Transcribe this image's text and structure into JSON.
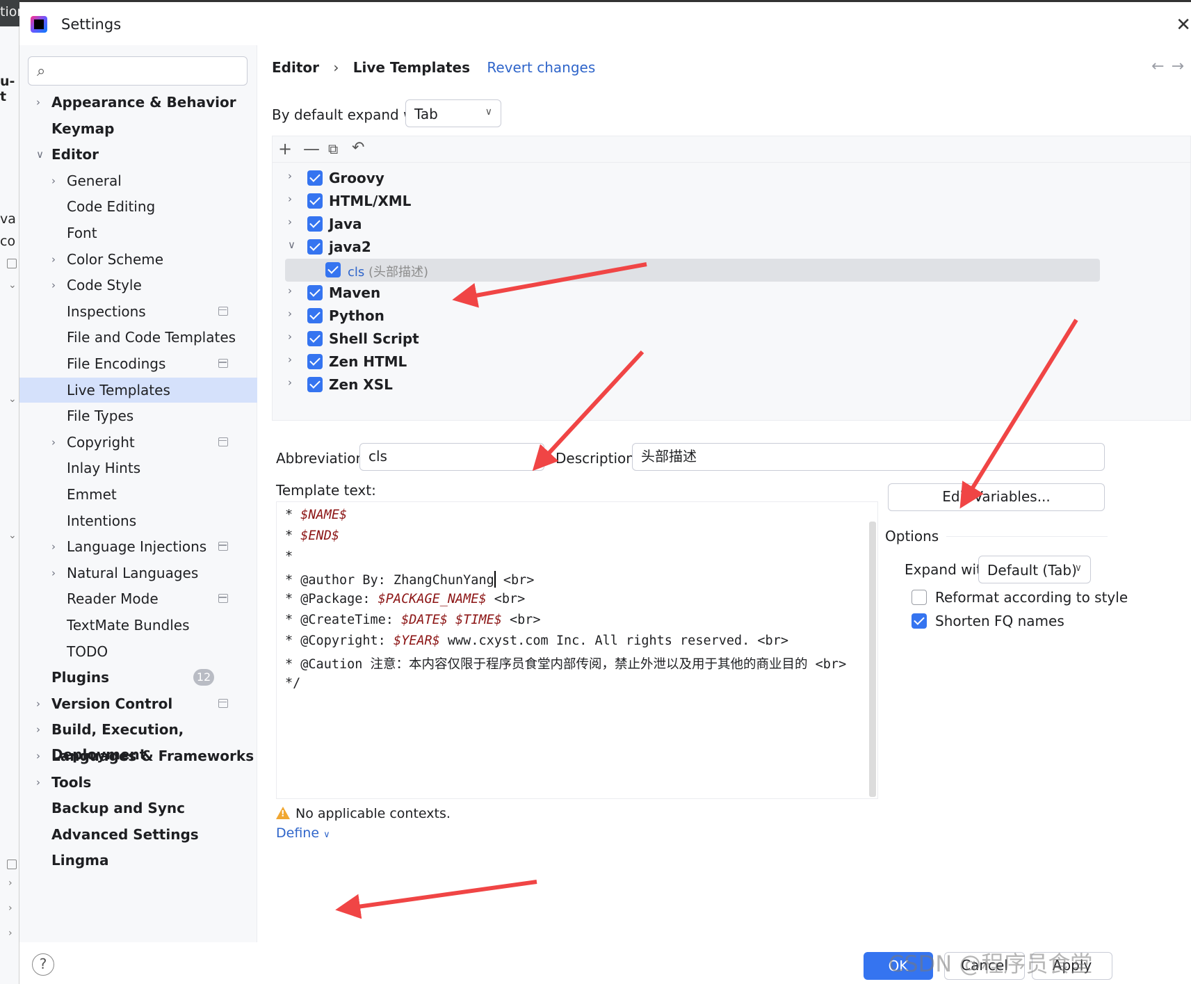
{
  "window": {
    "title": "Settings"
  },
  "background_fragments": [
    "tior",
    "u-t",
    "va",
    "co"
  ],
  "sidebar": {
    "search_placeholder": "",
    "items": [
      {
        "label": "Appearance & Behavior",
        "bold": true,
        "chevron": "right"
      },
      {
        "label": "Keymap",
        "bold": true
      },
      {
        "label": "Editor",
        "bold": true,
        "chevron": "down"
      },
      {
        "label": "General",
        "chevron": "right"
      },
      {
        "label": "Code Editing"
      },
      {
        "label": "Font"
      },
      {
        "label": "Color Scheme",
        "chevron": "right"
      },
      {
        "label": "Code Style",
        "chevron": "right"
      },
      {
        "label": "Inspections",
        "project_icon": true
      },
      {
        "label": "File and Code Templates"
      },
      {
        "label": "File Encodings",
        "project_icon": true
      },
      {
        "label": "Live Templates",
        "selected": true
      },
      {
        "label": "File Types"
      },
      {
        "label": "Copyright",
        "chevron": "right",
        "project_icon": true
      },
      {
        "label": "Inlay Hints"
      },
      {
        "label": "Emmet"
      },
      {
        "label": "Intentions"
      },
      {
        "label": "Language Injections",
        "chevron": "right",
        "project_icon": true
      },
      {
        "label": "Natural Languages",
        "chevron": "right"
      },
      {
        "label": "Reader Mode",
        "project_icon": true
      },
      {
        "label": "TextMate Bundles"
      },
      {
        "label": "TODO"
      },
      {
        "label": "Plugins",
        "bold": true,
        "badge": "12"
      },
      {
        "label": "Version Control",
        "bold": true,
        "chevron": "right",
        "project_icon": true
      },
      {
        "label": "Build, Execution, Deployment",
        "bold": true,
        "chevron": "right"
      },
      {
        "label": "Languages & Frameworks",
        "bold": true,
        "chevron": "right"
      },
      {
        "label": "Tools",
        "bold": true,
        "chevron": "right"
      },
      {
        "label": "Backup and Sync",
        "bold": true
      },
      {
        "label": "Advanced Settings",
        "bold": true
      },
      {
        "label": "Lingma",
        "bold": true
      }
    ]
  },
  "breadcrumb": {
    "parent": "Editor",
    "separator": "›",
    "current": "Live Templates",
    "revert": "Revert changes"
  },
  "expand": {
    "label": "By default expand with",
    "value": "Tab"
  },
  "template_groups": [
    {
      "name": "Groovy",
      "checked": true,
      "expanded": false
    },
    {
      "name": "HTML/XML",
      "checked": true,
      "expanded": false
    },
    {
      "name": "Java",
      "checked": true,
      "expanded": false
    },
    {
      "name": "java2",
      "checked": true,
      "expanded": true
    },
    {
      "name": "Maven",
      "checked": true,
      "expanded": false
    },
    {
      "name": "Python",
      "checked": true,
      "expanded": false
    },
    {
      "name": "Shell Script",
      "checked": true,
      "expanded": false
    },
    {
      "name": "Zen HTML",
      "checked": true,
      "expanded": false
    },
    {
      "name": "Zen XSL",
      "checked": true,
      "expanded": false
    }
  ],
  "selected_template": {
    "abbreviation": "cls",
    "description": "(头部描述)",
    "checked": true
  },
  "fields": {
    "abbreviation_label": "Abbreviation:",
    "abbreviation_value": "cls",
    "description_label": "Description:",
    "description_value": "头部描述",
    "template_text_label": "Template text:"
  },
  "template_text": [
    {
      "pre": "* ",
      "var": "$NAME$",
      "post": ""
    },
    {
      "pre": "* ",
      "var": "$END$",
      "post": ""
    },
    {
      "pre": "*",
      "var": "",
      "post": ""
    },
    {
      "pre": "* @author By: ZhangChunYang",
      "var": "",
      "post": " <br>"
    },
    {
      "pre": "* @Package: ",
      "var": "$PACKAGE_NAME$",
      "post": " <br>"
    },
    {
      "pre": "* @CreateTime: ",
      "var": "$DATE$ $TIME$",
      "post": " <br>"
    },
    {
      "pre": "* @Copyright: ",
      "var": "$YEAR$",
      "post": " www.cxyst.com Inc. All rights reserved. <br>"
    },
    {
      "pre": "* @Caution 注意：本内容仅限于程序员食堂内部传阅，禁止外泄以及用于其他的商业目的 <br>",
      "var": "",
      "post": ""
    },
    {
      "pre": "*/",
      "var": "",
      "post": ""
    }
  ],
  "edit_variables": "Edit Variables...",
  "options": {
    "title": "Options",
    "expand_label": "Expand with",
    "expand_value": "Default (Tab)",
    "reformat_label": "Reformat according to style",
    "reformat_checked": false,
    "shorten_label": "Shorten FQ names",
    "shorten_checked": true
  },
  "contexts": {
    "warning": "No applicable contexts.",
    "define": "Define"
  },
  "footer": {
    "help": "?",
    "ok": "OK",
    "cancel": "Cancel",
    "apply": "Apply"
  },
  "watermark": "CSDN @程序员食堂",
  "colors": {
    "accent": "#3574f0",
    "link": "#2f65ca",
    "selection": "#d5e1fb",
    "annotation_arrow": "#f04545",
    "variable": "#8c1515"
  }
}
